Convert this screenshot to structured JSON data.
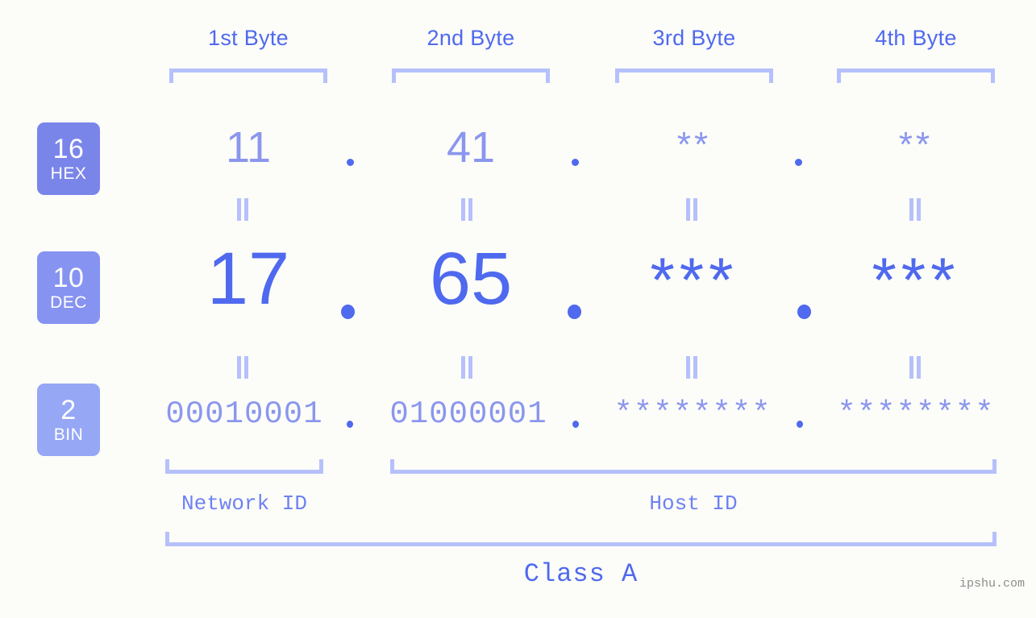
{
  "meta": {
    "background_color": "#fcfdf9",
    "accent_color": "#4f69ef",
    "muted_color": "#8b96ee",
    "bracket_color": "#b6c0fb",
    "watermark": "ipshu.com"
  },
  "byte_headers": [
    {
      "label": "1st Byte"
    },
    {
      "label": "2nd Byte"
    },
    {
      "label": "3rd Byte"
    },
    {
      "label": "4th Byte"
    }
  ],
  "radix_rows": [
    {
      "badge_number": "16",
      "badge_name": "HEX",
      "badge_color": "#7a85ea",
      "values": [
        "11",
        "41",
        "**",
        "**"
      ],
      "separator": "."
    },
    {
      "badge_number": "10",
      "badge_name": "DEC",
      "badge_color": "#8693f1",
      "values": [
        "17",
        "65",
        "***",
        "***"
      ],
      "separator": "."
    },
    {
      "badge_number": "2",
      "badge_name": "BIN",
      "badge_color": "#95a7f5",
      "values": [
        "00010001",
        "01000001",
        "********",
        "********"
      ],
      "separator": "."
    }
  ],
  "id_sections": [
    {
      "label": "Network ID"
    },
    {
      "label": "Host ID"
    }
  ],
  "class_label": "Class A"
}
